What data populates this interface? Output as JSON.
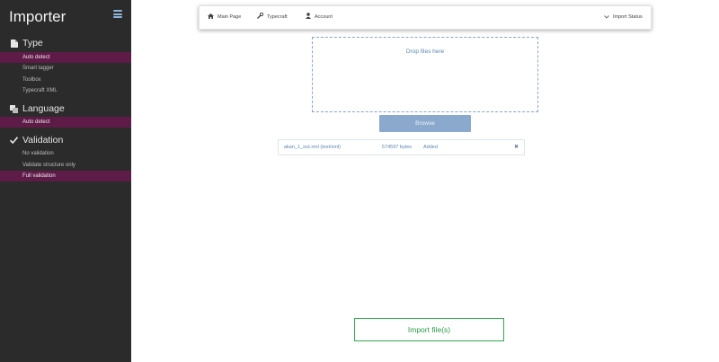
{
  "sidebar": {
    "brand": "Importer",
    "menu_icon": "hamburger-icon",
    "sections": [
      {
        "title": "Type",
        "icon": "file-icon",
        "items": [
          {
            "label": "Auto detect",
            "active": true
          },
          {
            "label": "Smart tagger",
            "active": false
          },
          {
            "label": "Toolbox",
            "active": false
          },
          {
            "label": "Typecraft XML",
            "active": false
          }
        ]
      },
      {
        "title": "Language",
        "icon": "language-icon",
        "items": [
          {
            "label": "Auto detect",
            "active": true
          }
        ]
      },
      {
        "title": "Validation",
        "icon": "check-icon",
        "items": [
          {
            "label": "No validation",
            "active": false
          },
          {
            "label": "Validate structure only",
            "active": false
          },
          {
            "label": "Full validation",
            "active": true
          }
        ]
      }
    ]
  },
  "topnav": {
    "main_page": "Main Page",
    "typecraft": "Typecraft",
    "account": "Account",
    "import_status": "Import Status"
  },
  "dropzone": {
    "text": "Drop files here"
  },
  "browse_label": "Browse",
  "files": [
    {
      "name": "akan_1_out.xml (text/xml)",
      "size": "574597 bytes",
      "status": "Added"
    }
  ],
  "import_label": "Import file(s)",
  "colors": {
    "sidebar_bg": "#2b2b2b",
    "active_item": "#5e1b47",
    "accent_blue": "#5c84b1",
    "browse_bg": "#8aa9cc",
    "import_green": "#2e9a49"
  }
}
